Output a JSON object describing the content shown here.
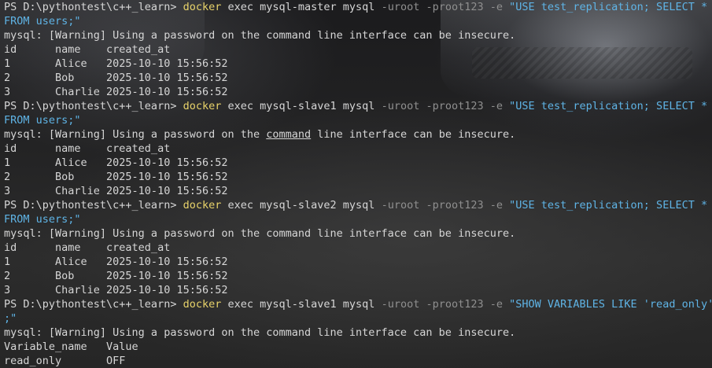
{
  "colors": {
    "text": "#d6d6d6",
    "command": "#e8d36a",
    "flag": "#8f8f8f",
    "string": "#5fb4e6"
  },
  "prompt": "PS D:\\pythontest\\c++_learn> ",
  "lines": [
    {
      "type": "cmd",
      "prompt": "PS D:\\pythontest\\c++_learn> ",
      "cmd": "docker",
      "args": " exec mysql-master mysql ",
      "flags": "-uroot -proot123 -e ",
      "str": "\"USE test_replication; SELECT *"
    },
    {
      "type": "str",
      "text": "FROM users;\""
    },
    {
      "type": "plain",
      "text": "mysql: [Warning] Using a password on the command line interface can be insecure."
    },
    {
      "type": "plain",
      "text": "id\tname\tcreated_at"
    },
    {
      "type": "plain",
      "text": "1\tAlice\t2025-10-10 15:56:52"
    },
    {
      "type": "plain",
      "text": "2\tBob\t2025-10-10 15:56:52"
    },
    {
      "type": "plain",
      "text": "3\tCharlie\t2025-10-10 15:56:52"
    },
    {
      "type": "cmd",
      "prompt": "PS D:\\pythontest\\c++_learn> ",
      "cmd": "docker",
      "args": " exec mysql-slave1 mysql ",
      "flags": "-uroot -proot123 -e ",
      "str": "\"USE test_replication; SELECT *"
    },
    {
      "type": "str",
      "text": "FROM users;\""
    },
    {
      "type": "warn-underline",
      "pre": "mysql: [Warning] Using a password on the ",
      "underlined": "command",
      "post": " line interface can be insecure."
    },
    {
      "type": "plain",
      "text": "id\tname\tcreated_at"
    },
    {
      "type": "plain",
      "text": "1\tAlice\t2025-10-10 15:56:52"
    },
    {
      "type": "plain",
      "text": "2\tBob\t2025-10-10 15:56:52"
    },
    {
      "type": "plain",
      "text": "3\tCharlie\t2025-10-10 15:56:52"
    },
    {
      "type": "cmd",
      "prompt": "PS D:\\pythontest\\c++_learn> ",
      "cmd": "docker",
      "args": " exec mysql-slave2 mysql ",
      "flags": "-uroot -proot123 -e ",
      "str": "\"USE test_replication; SELECT *"
    },
    {
      "type": "str",
      "text": "FROM users;\""
    },
    {
      "type": "plain",
      "text": "mysql: [Warning] Using a password on the command line interface can be insecure."
    },
    {
      "type": "plain",
      "text": "id\tname\tcreated_at"
    },
    {
      "type": "plain",
      "text": "1\tAlice\t2025-10-10 15:56:52"
    },
    {
      "type": "plain",
      "text": "2\tBob\t2025-10-10 15:56:52"
    },
    {
      "type": "plain",
      "text": "3\tCharlie\t2025-10-10 15:56:52"
    },
    {
      "type": "cmd",
      "prompt": "PS D:\\pythontest\\c++_learn> ",
      "cmd": "docker",
      "args": " exec mysql-slave1 mysql ",
      "flags": "-uroot -proot123 -e ",
      "str": "\"SHOW VARIABLES LIKE 'read_only'"
    },
    {
      "type": "str",
      "text": ";\""
    },
    {
      "type": "plain",
      "text": "mysql: [Warning] Using a password on the command line interface can be insecure."
    },
    {
      "type": "plain",
      "text": "Variable_name\tValue"
    },
    {
      "type": "plain",
      "text": "read_only\tOFF"
    }
  ]
}
